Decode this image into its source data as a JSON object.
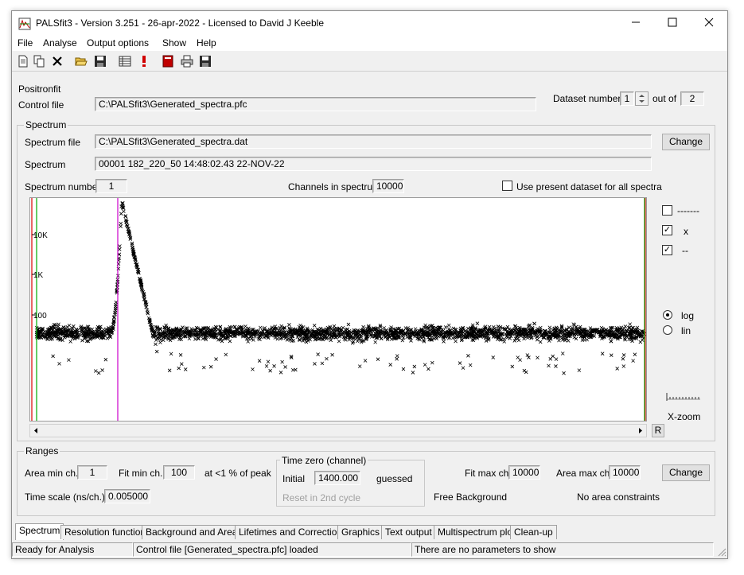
{
  "window": {
    "title": "PALSfit3 - Version 3.251 - 26-apr-2022 - Licensed to David J Keeble"
  },
  "menu": [
    "File",
    "Analyse",
    "Output options",
    "Show",
    "Help"
  ],
  "header": {
    "section_label": "Positronfit",
    "control_file_label": "Control file",
    "control_file_value": "C:\\PALSfit3\\Generated_spectra.pfc",
    "dataset_label": "Dataset number",
    "dataset_value": "1",
    "out_of_label": "out of",
    "out_of_value": "2"
  },
  "spectrum": {
    "group_title": "Spectrum",
    "file_label": "Spectrum file",
    "file_value": "C:\\PALSfit3\\Generated_spectra.dat",
    "change_label": "Change",
    "spectrum_label": "Spectrum",
    "spectrum_value": "00001 182_220_50 14:48:02.43 22-NOV-22",
    "number_label": "Spectrum number",
    "number_value": "1",
    "channels_label": "Channels in spectrum",
    "channels_value": "10000",
    "use_present_label": "Use present dataset for all spectra"
  },
  "plot": {
    "y_tick_labels": [
      "10K",
      "1K",
      "100"
    ],
    "legend": [
      {
        "symbol": "-------",
        "checked": false
      },
      {
        "symbol": "x",
        "checked": true
      },
      {
        "symbol": "--",
        "checked": true
      }
    ],
    "scale_log_label": "log",
    "scale_lin_label": "lin",
    "scale_selected": "log",
    "xzoom_label": "X-zoom",
    "reset_label": "R",
    "peak_color": "#cc00cc",
    "left_limit_color": "#00aa00",
    "right_limit_color": "#00aa00",
    "area_limit_color": "#dd0000"
  },
  "chart_data": {
    "type": "scatter",
    "title": "",
    "xlabel": "",
    "ylabel": "",
    "y_scale": "log",
    "x_range": [
      0,
      10000
    ],
    "y_range": [
      1,
      40000
    ],
    "peak_channel": 1400,
    "peak_counts": 40000,
    "background_counts": 20,
    "y_ticks": [
      10000,
      1000,
      100
    ]
  },
  "ranges": {
    "group_title": "Ranges",
    "area_min_label": "Area min ch.",
    "area_min_value": "1",
    "fit_min_label": "Fit min ch.",
    "fit_min_value": "100",
    "peak_text": "at <1 % of peak",
    "timescale_label": "Time scale (ns/ch.)",
    "timescale_value": "0.005000",
    "timezero_title": "Time zero (channel)",
    "initial_label": "Initial",
    "initial_value": "1400.000",
    "guessed_label": "guessed",
    "reset_label": "Reset in 2nd cycle",
    "fit_max_label": "Fit max ch.",
    "fit_max_value": "10000",
    "area_max_label": "Area max ch.",
    "area_max_value": "10000",
    "change_label": "Change",
    "free_bg_label": "Free Background",
    "no_area_label": "No area constraints"
  },
  "tabs": [
    "Spectrum",
    "Resolution function",
    "Background and Area",
    "Lifetimes and Corrections",
    "Graphics",
    "Text output",
    "Multispectrum plot",
    "Clean-up"
  ],
  "status": {
    "ready": "Ready for Analysis",
    "control": "Control file [Generated_spectra.pfc] loaded",
    "params": "There are no parameters to show"
  }
}
